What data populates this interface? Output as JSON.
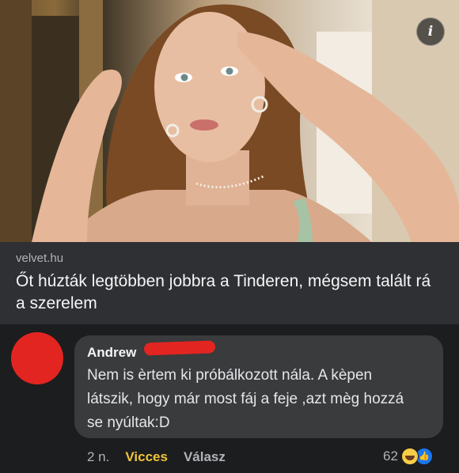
{
  "link": {
    "domain": "velvet.hu",
    "headline": "Őt húzták legtöbben jobbra a Tinderen, mégsem talált rá a szerelem",
    "info_label": "i"
  },
  "comment": {
    "author": "Andrew",
    "text": "Nem is èrtem ki próbálkozott nála. A kèpen látszik, hogy már most fáj a feje ,azt mèg hozzá se nyúltak:D",
    "time": "2 n.",
    "reaction_label": "Vicces",
    "reply_label": "Válasz",
    "reaction_count": "62",
    "reaction_icons": [
      "haha-icon",
      "like-icon"
    ]
  }
}
